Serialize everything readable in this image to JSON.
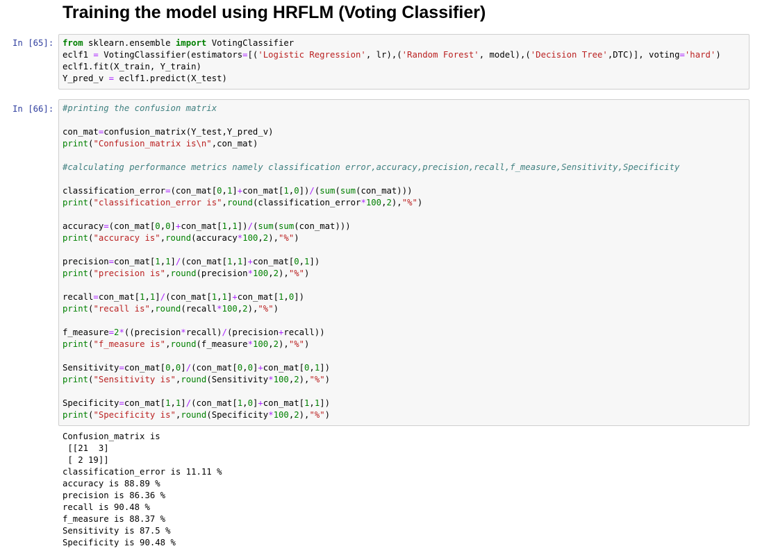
{
  "heading": "Training the model using HRFLM (Voting Classifier)",
  "cells": [
    {
      "prompt": "In [65]:",
      "code": [
        "from sklearn.ensemble import VotingClassifier",
        "eclf1 = VotingClassifier(estimators=[('Logistic Regression', lr),('Random Forest', model),('Decision Tree',DTC)], voting='hard')",
        "eclf1.fit(X_train, Y_train)",
        "Y_pred_v = eclf1.predict(X_test)"
      ]
    },
    {
      "prompt": "In [66]:",
      "code": [
        "#printing the confusion matrix",
        "",
        "con_mat=confusion_matrix(Y_test,Y_pred_v)",
        "print(\"Confusion_matrix is\\n\",con_mat)",
        "",
        "#calculating performance metrics namely classification error,accuracy,precision,recall,f_measure,Sensitivity,Specificity",
        "",
        "classification_error=(con_mat[0,1]+con_mat[1,0])/(sum(sum(con_mat)))",
        "print(\"classification_error is\",round(classification_error*100,2),\"%\")",
        "",
        "accuracy=(con_mat[0,0]+con_mat[1,1])/(sum(sum(con_mat)))",
        "print(\"accuracy is\",round(accuracy*100,2),\"%\")",
        "",
        "precision=con_mat[1,1]/(con_mat[1,1]+con_mat[0,1])",
        "print(\"precision is\",round(precision*100,2),\"%\")",
        "",
        "recall=con_mat[1,1]/(con_mat[1,1]+con_mat[1,0])",
        "print(\"recall is\",round(recall*100,2),\"%\")",
        "",
        "f_measure=2*((precision*recall)/(precision+recall))",
        "print(\"f_measure is\",round(f_measure*100,2),\"%\")",
        "",
        "Sensitivity=con_mat[0,0]/(con_mat[0,0]+con_mat[0,1])",
        "print(\"Sensitivity is\",round(Sensitivity*100,2),\"%\")",
        "",
        "Specificity=con_mat[1,1]/(con_mat[1,0]+con_mat[1,1])",
        "print(\"Specificity is\",round(Specificity*100,2),\"%\")"
      ],
      "output": [
        "Confusion_matrix is",
        " [[21  3]",
        " [ 2 19]]",
        "classification_error is 11.11 %",
        "accuracy is 88.89 %",
        "precision is 86.36 %",
        "recall is 90.48 %",
        "f_measure is 88.37 %",
        "Sensitivity is 87.5 %",
        "Specificity is 90.48 %"
      ]
    }
  ]
}
